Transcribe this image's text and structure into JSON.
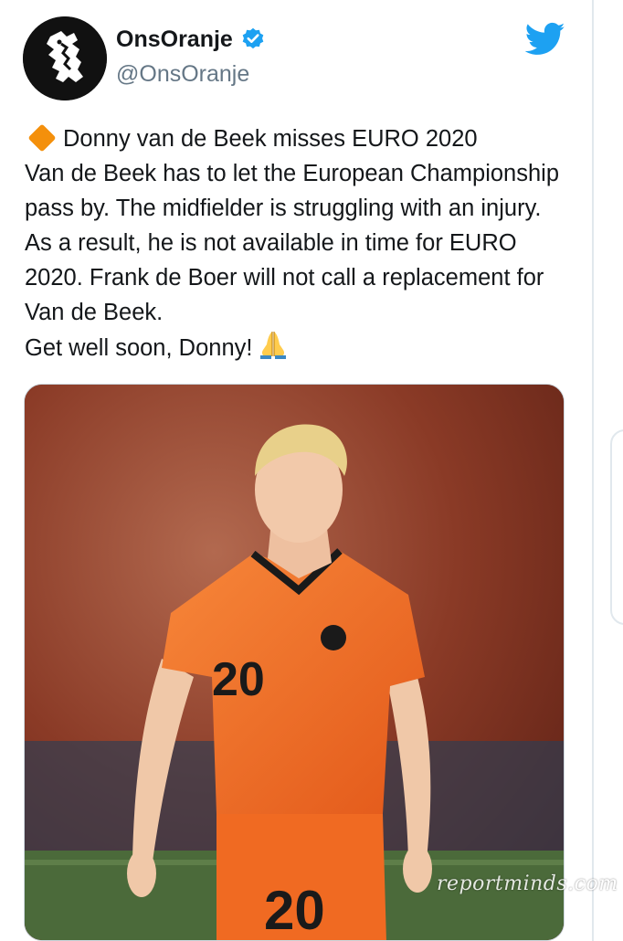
{
  "account": {
    "display_name": "OnsOranje",
    "handle": "@OnsOranje",
    "verified": true,
    "verified_icon": "verified-badge-icon",
    "avatar_icon": "lion-logo-icon"
  },
  "platform_icon": "twitter-bird-icon",
  "tweet": {
    "line1": "Donny van de Beek misses EURO 2020",
    "body": "Van de Beek has to let the European Championship pass by. The midfielder is struggling with an injury. As a result, he is not available in time for EURO 2020. Frank de Boer will not call a replacement for Van de Beek.",
    "closing": "Get well soon, Donny!",
    "lead_emoji": "orange-diamond-icon",
    "trailing_emoji": "folded-hands-icon"
  },
  "media": {
    "jersey_number": "20",
    "shorts_number": "20",
    "watermark": "reportminds.com"
  },
  "colors": {
    "verified_blue": "#1da1f2",
    "twitter_blue": "#1da1f2",
    "jersey_orange": "#f36c21",
    "handle_gray": "#657786"
  }
}
